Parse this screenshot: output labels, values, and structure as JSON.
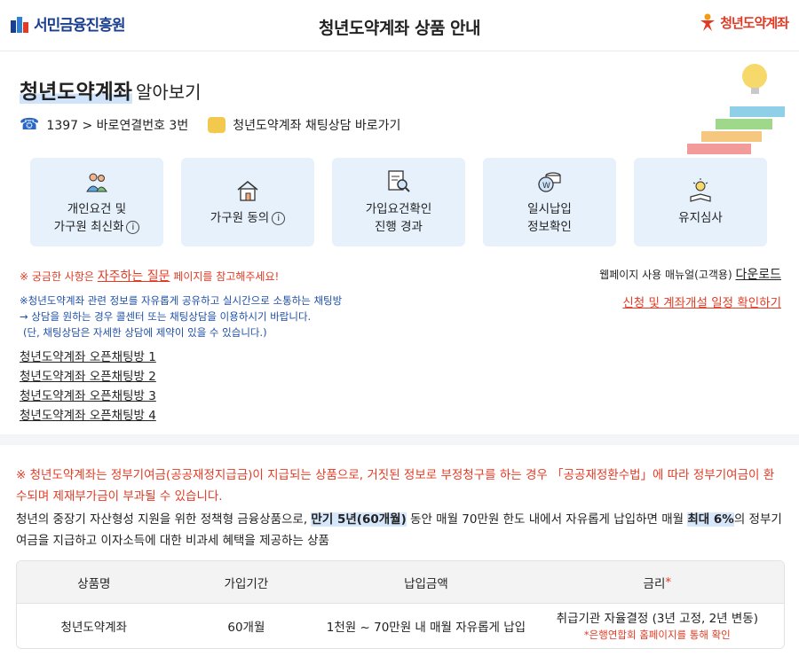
{
  "header": {
    "org_name": "서민금융진흥원",
    "title": "청년도약계좌 상품 안내",
    "brand_name": "청년도약계좌"
  },
  "intro": {
    "title_highlight": "청년도약계좌",
    "title_rest": "알아보기",
    "phone": "1397 > 바로연결번호 3번",
    "chat": "청년도약계좌 채팅상담 바로가기"
  },
  "cards": [
    {
      "line1": "개인요건 및",
      "line2": "가구원 최신화",
      "info": true
    },
    {
      "line1": "가구원 동의",
      "line2": "",
      "info": true
    },
    {
      "line1": "가입요건확인",
      "line2": "진행 경과",
      "info": false
    },
    {
      "line1": "일시납입",
      "line2": "정보확인",
      "info": false
    },
    {
      "line1": "유지심사",
      "line2": "",
      "info": false
    }
  ],
  "info_mark": "i",
  "faq": {
    "prefix": "※ 궁금한 사항은 ",
    "link": "자주하는 질문",
    "suffix": " 페이지를 참고해주세요!"
  },
  "manual": {
    "text": "웹페이지 사용 매뉴얼(고객용) ",
    "link": "다운로드"
  },
  "schedule_link": "신청 및 계좌개설 일정 확인하기",
  "chat_notice": {
    "line1": "※청년도약계좌 관련 정보를 자유롭게 공유하고 실시간으로 소통하는 채팅방",
    "line2": "→ 상담을 원하는 경우 콜센터 또는 채팅상담을 이용하시기 바랍니다.",
    "line3": "(단, 채팅상담은 자세한 상담에 제약이 있을 수 있습니다.)"
  },
  "open_rooms": [
    "청년도약계좌 오픈채팅방 1",
    "청년도약계좌 오픈채팅방 2",
    "청년도약계좌 오픈채팅방 3",
    "청년도약계좌 오픈채팅방 4"
  ],
  "warning": "※ 청년도약계좌는 정부기여금(공공재정지급금)이 지급되는 상품으로, 거짓된 정보로 부정청구를 하는 경우 「공공재정환수법」에 따라 정부기여금이 환수되며 제재부가금이 부과될 수 있습니다.",
  "description": {
    "part1": "청년의 중장기 자산형성 지원을 위한 정책형 금융상품으로, ",
    "hl1": "만기 5년(60개월)",
    "part2": " 동안 매월 70만원 한도 내에서 자유롭게 납입하면 매월 ",
    "hl2": "최대 6%",
    "part3": "의 정부기여금을 지급하고 이자소득에 대한 비과세 혜택을 제공하는 상품"
  },
  "table": {
    "headers": [
      "상품명",
      "가입기간",
      "납입금액",
      "금리"
    ],
    "required_mark": "*",
    "row": {
      "name": "청년도약계좌",
      "period": "60개월",
      "amount": "1천원 ~ 70만원 내 매월 자유롭게 납입",
      "rate": "취급기관 자율결정 (3년 고정, 2년 변동)",
      "rate_note": "*은행연합회 홈페이지를 통해 확인"
    }
  },
  "colors": {
    "accent_blue": "#1f4fa8",
    "accent_red": "#e23b25",
    "card_bg": "#e6f1fc"
  }
}
